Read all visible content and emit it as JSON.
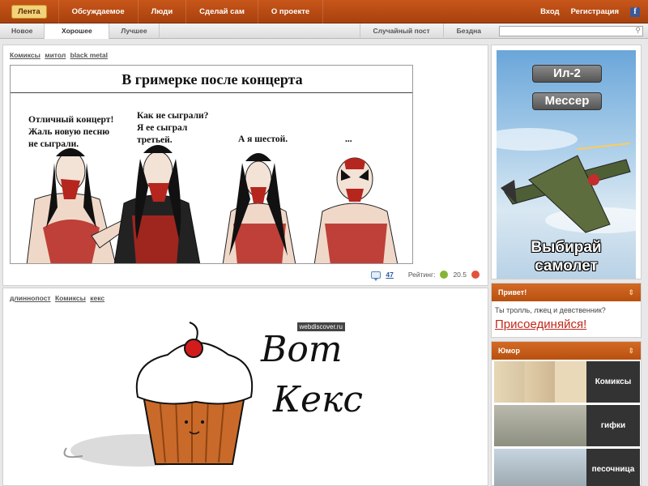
{
  "topnav": {
    "items": [
      "Лента",
      "Обсуждаемое",
      "Люди",
      "Сделай сам",
      "О проекте"
    ],
    "login": "Вход",
    "register": "Регистрация"
  },
  "subnav": {
    "tabs": [
      "Новое",
      "Хорошее",
      "Лучшее"
    ],
    "random": "Случайный пост",
    "abyss": "Бездна",
    "search_placeholder": ""
  },
  "post1": {
    "tags": [
      "Комиксы",
      "митол",
      "black metal"
    ],
    "comic_title": "В гримерке после концерта",
    "bubbles": [
      "Отличный концерт!\nЖаль новую песню\nне сыграли.",
      "Как не сыграли?\nЯ ее сыграл\nтретьей.",
      "А я шестой.",
      "..."
    ],
    "comments": "47",
    "rating_label": "Рейтинг:",
    "rating": "20.5"
  },
  "post2": {
    "tags": [
      "длиннопост",
      "Комиксы",
      "кекс"
    ],
    "watermark": "webdiscover.ru",
    "hand_line1": "Вот",
    "hand_line2": "Кекс"
  },
  "ad": {
    "btn1": "Ил-2",
    "btn2": "Мессер",
    "text": "Выбирай\nсамолет"
  },
  "widget_hello": {
    "title": "Привет!",
    "text": "Ты тролль, лжец и девственник?",
    "join": "Присоединяйся!"
  },
  "widget_humor": {
    "title": "Юмор",
    "tiles": [
      "Комиксы",
      "гифки",
      "песочница"
    ]
  },
  "colors": {
    "accent": "#b8500f",
    "link": "#2a59a3",
    "join": "#c0281b"
  }
}
